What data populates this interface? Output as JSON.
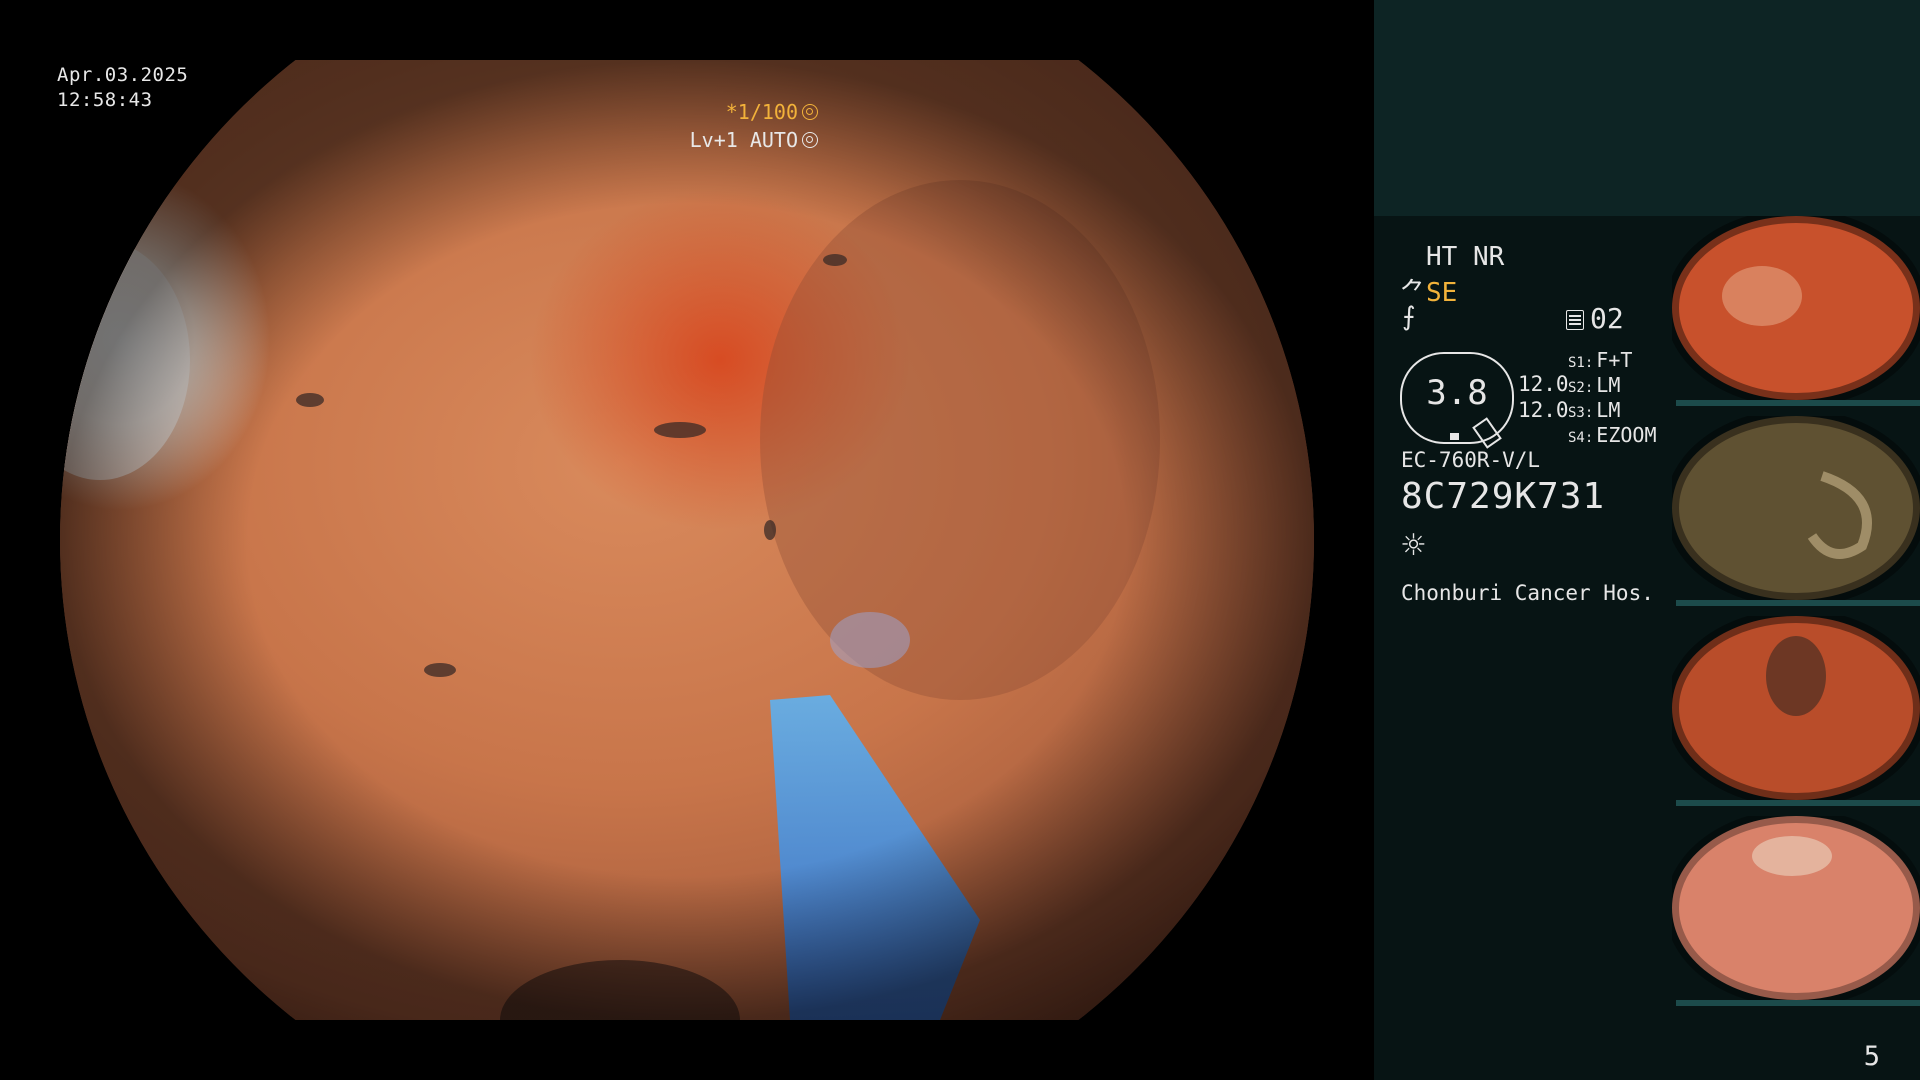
{
  "overlay": {
    "date": "Apr.03.2025",
    "time": "12:58:43",
    "shutter": "*1/100",
    "level": "Lv+1 AUTO"
  },
  "panel": {
    "mode_line": "HT NR",
    "enhancement": "SE",
    "memo": "02",
    "gauge_value": "3.8",
    "value1": "12.0",
    "value2": "12.0",
    "switches": [
      {
        "key": "S1:",
        "value": "F+T"
      },
      {
        "key": "S2:",
        "value": "LM"
      },
      {
        "key": "S3:",
        "value": "LM"
      },
      {
        "key": "S4:",
        "value": "EZOOM"
      }
    ],
    "model": "EC-760R-V/L",
    "serial": "8C729K731",
    "hospital": "Chonburi Cancer Hos."
  },
  "icons": [
    "shutter-icon",
    "auto-iris-icon",
    "scope-tip-icon",
    "freeze-icon",
    "memo-icon",
    "light-icon"
  ],
  "thumbnails": [
    {
      "id": "thumb-1",
      "tone": "#c8512c"
    },
    {
      "id": "thumb-2",
      "tone": "#5f5132"
    },
    {
      "id": "thumb-3",
      "tone": "#b94d2a"
    },
    {
      "id": "thumb-4",
      "tone": "#d9826a"
    }
  ],
  "page_number": "5",
  "colors": {
    "panel_bg": "#071414",
    "panel_top_bg": "#0d2424",
    "highlight": "#f2b23a",
    "text": "#e6e6e6"
  }
}
